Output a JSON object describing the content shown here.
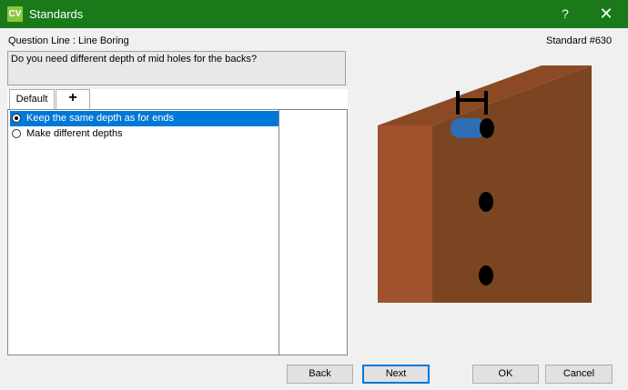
{
  "window": {
    "app_icon_text": "CV",
    "title": "Standards",
    "help": "?",
    "close": "✕"
  },
  "question": {
    "line_label": "Question Line : Line Boring",
    "standard_label": "Standard #630",
    "text": "Do you need different depth of mid holes for the backs?"
  },
  "tabs": [
    {
      "label": "Default"
    },
    {
      "label": "+"
    }
  ],
  "options": [
    {
      "label": "Keep the same depth as for ends",
      "selected": true
    },
    {
      "label": "Make different depths",
      "selected": false
    }
  ],
  "buttons": {
    "back": "Back",
    "next": "Next",
    "ok": "OK",
    "cancel": "Cancel"
  },
  "colors": {
    "titlebar": "#1a7a1a",
    "selection": "#0078d7",
    "panel_front": "#a0522d",
    "panel_face": "#7a4520",
    "dowel": "#2f6db5"
  }
}
